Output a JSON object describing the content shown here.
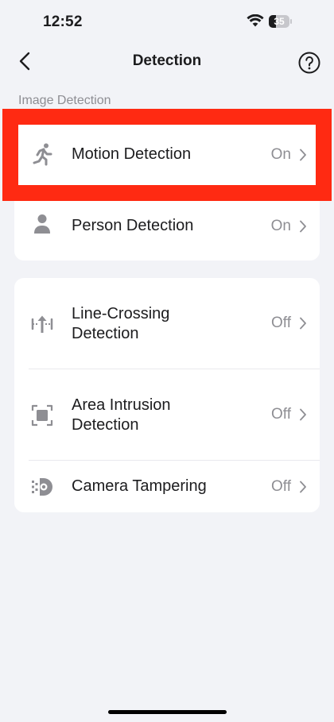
{
  "status": {
    "time": "12:52",
    "battery": "35",
    "battery_level": 0.35
  },
  "nav": {
    "title": "Detection",
    "back_icon": "chevron-left-icon",
    "help_icon": "question-circle-icon"
  },
  "section": {
    "label": "Image Detection"
  },
  "image_detection": [
    {
      "label": "Motion Detection",
      "value": "On",
      "icon": "running-person-icon"
    },
    {
      "label": "Person Detection",
      "value": "On",
      "icon": "person-icon"
    }
  ],
  "smart_detection": [
    {
      "label_line1": "Line-Crossing",
      "label_line2": "Detection",
      "value": "Off",
      "icon": "line-crossing-icon"
    },
    {
      "label_line1": "Area Intrusion",
      "label_line2": "Detection",
      "value": "Off",
      "icon": "area-intrusion-icon"
    },
    {
      "label": "Camera Tampering",
      "value": "Off",
      "icon": "camera-tampering-icon"
    }
  ],
  "colors": {
    "highlight": "#ff2a12",
    "background": "#f2f3f7",
    "secondary_text": "#8e8e93"
  }
}
